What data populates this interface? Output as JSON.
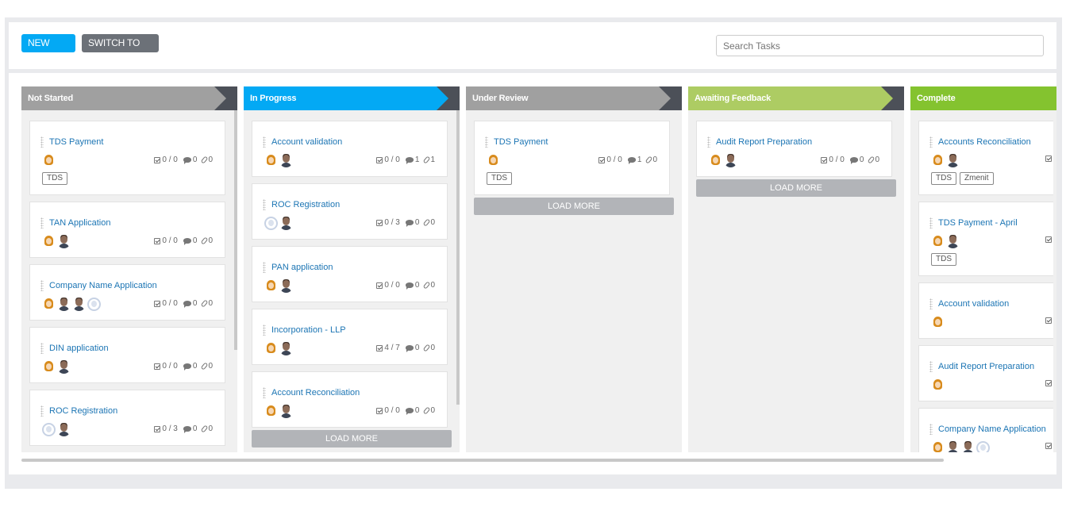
{
  "toolbar": {
    "new_task_label": "NEW TASK",
    "switch_label": "SWITCH TO LIST",
    "search_placeholder": "Search Tasks"
  },
  "colors": {
    "not_started": "#a0a0a0",
    "in_progress": "#03a9f4",
    "under_review": "#a0a0a0",
    "awaiting_feedback": "#adcc63",
    "complete": "#84c32f"
  },
  "columns": [
    {
      "title": "Not Started",
      "cards": [
        {
          "title": "TDS Payment",
          "avatars": [
            "female"
          ],
          "checklist": "0 / 0",
          "comments": "0",
          "attachments": "0",
          "tags": [
            "TDS"
          ]
        },
        {
          "title": "TAN Application",
          "avatars": [
            "female",
            "male"
          ],
          "checklist": "0 / 0",
          "comments": "0",
          "attachments": "0",
          "tags": []
        },
        {
          "title": "Company Name Application",
          "avatars": [
            "female",
            "male",
            "male",
            "blank"
          ],
          "checklist": "0 / 0",
          "comments": "0",
          "attachments": "0",
          "tags": []
        },
        {
          "title": "DIN application",
          "avatars": [
            "female",
            "male"
          ],
          "checklist": "0 / 0",
          "comments": "0",
          "attachments": "0",
          "tags": []
        },
        {
          "title": "ROC Registration",
          "avatars": [
            "blank",
            "male"
          ],
          "checklist": "0 / 3",
          "comments": "0",
          "attachments": "0",
          "tags": []
        }
      ]
    },
    {
      "title": "In Progress",
      "load_more": "LOAD MORE",
      "cards": [
        {
          "title": "Account validation",
          "avatars": [
            "female",
            "male"
          ],
          "checklist": "0 / 0",
          "comments": "1",
          "attachments": "1",
          "tags": []
        },
        {
          "title": "ROC Registration",
          "avatars": [
            "blank",
            "male"
          ],
          "checklist": "0 / 3",
          "comments": "0",
          "attachments": "0",
          "tags": []
        },
        {
          "title": "PAN application",
          "avatars": [
            "female",
            "male"
          ],
          "checklist": "0 / 0",
          "comments": "0",
          "attachments": "0",
          "tags": []
        },
        {
          "title": "Incorporation - LLP",
          "avatars": [
            "female",
            "male"
          ],
          "checklist": "4 / 7",
          "comments": "0",
          "attachments": "0",
          "tags": []
        },
        {
          "title": "Account Reconciliation",
          "avatars": [
            "female",
            "male"
          ],
          "checklist": "0 / 0",
          "comments": "0",
          "attachments": "0",
          "tags": []
        }
      ]
    },
    {
      "title": "Under Review",
      "load_more": "LOAD MORE",
      "cards": [
        {
          "title": "TDS Payment",
          "avatars": [
            "female"
          ],
          "checklist": "0 / 0",
          "comments": "1",
          "attachments": "0",
          "tags": [
            "TDS"
          ]
        }
      ]
    },
    {
      "title": "Awaiting Feedback",
      "load_more": "LOAD MORE",
      "cards": [
        {
          "title": "Audit Report Preparation",
          "avatars": [
            "female",
            "male"
          ],
          "checklist": "0 / 0",
          "comments": "0",
          "attachments": "0",
          "tags": []
        }
      ]
    },
    {
      "title": "Complete",
      "cards": [
        {
          "title": "Accounts Reconciliation",
          "avatars": [
            "female",
            "male"
          ],
          "tags": [
            "TDS",
            "Zmenit"
          ]
        },
        {
          "title": "TDS Payment - April",
          "avatars": [
            "female",
            "male"
          ],
          "tags": [
            "TDS"
          ]
        },
        {
          "title": "Account validation",
          "avatars": [
            "female"
          ],
          "tags": []
        },
        {
          "title": "Audit Report Preparation",
          "avatars": [
            "female"
          ],
          "tags": []
        },
        {
          "title": "Company Name Application",
          "avatars": [
            "female",
            "male",
            "male",
            "blank"
          ],
          "tags": []
        }
      ]
    }
  ]
}
